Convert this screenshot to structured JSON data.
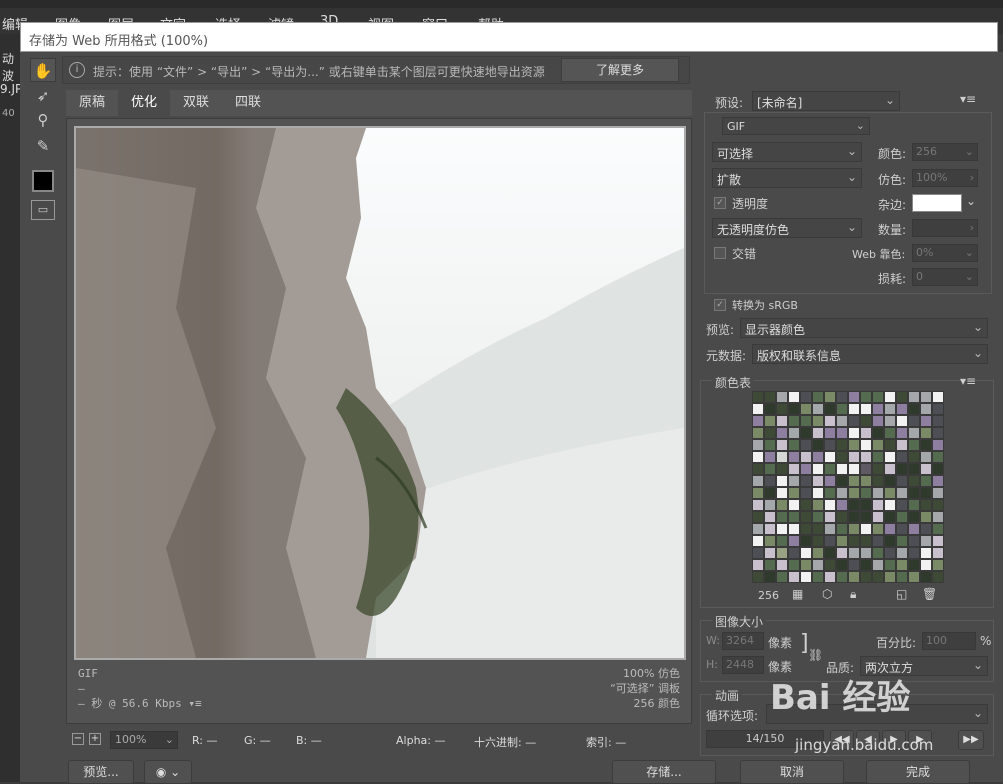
{
  "background_app": {
    "menu_items": [
      "编辑",
      "图像",
      "图层",
      "文字",
      "选择",
      "滤镜",
      "3D",
      "视图",
      "窗口",
      "帮助"
    ],
    "left_fragments": [
      "动波",
      "9.JP",
      "40"
    ]
  },
  "dialog": {
    "title": "存储为 Web 所用格式 (100%)",
    "hint": "提示：使用 “文件” > “导出” > “导出为...” 或右键单击某个图层可更快速地导出资源",
    "learn_more": "了解更多",
    "tabs": [
      {
        "label": "原稿"
      },
      {
        "label": "优化"
      },
      {
        "label": "双联"
      },
      {
        "label": "四联"
      }
    ],
    "preview_info": {
      "format": "GIF",
      "size": "—",
      "time": "— 秒 @ 56.6 Kbps",
      "dither": "100% 仿色",
      "palette": "“可选择” 调板",
      "colors": "256 颜色"
    },
    "status": {
      "zoom": "100%",
      "r": "R: —",
      "g": "G: —",
      "b": "B: —",
      "alpha": "Alpha: —",
      "hex": "十六进制: —",
      "index": "索引: —"
    },
    "buttons": {
      "preview": "预览...",
      "save": "存储...",
      "cancel": "取消",
      "done": "完成"
    }
  },
  "settings": {
    "preset_label": "预设:",
    "preset_value": "[未命名]",
    "format": "GIF",
    "reduction": "可选择",
    "dither_algo": "扩散",
    "transparency": "透明度",
    "matte_dither": "无透明度仿色",
    "interlaced": "交错",
    "colors_label": "颜色:",
    "colors_value": "256",
    "dither_label": "仿色:",
    "dither_value": "100%",
    "matte_label": "杂边:",
    "amount_label": "数量:",
    "web_snap_label": "Web 靠色:",
    "web_snap_value": "0%",
    "lossy_label": "损耗:",
    "lossy_value": "0",
    "convert_srgb": "转换为 sRGB",
    "preview_label": "预览:",
    "preview_value": "显示器颜色",
    "metadata_label": "元数据:",
    "metadata_value": "版权和联系信息"
  },
  "color_table": {
    "title": "颜色表",
    "count": "256"
  },
  "image_size": {
    "title": "图像大小",
    "w_label": "W:",
    "w_value": "3264",
    "h_label": "H:",
    "h_value": "2448",
    "unit": "像素",
    "percent_label": "百分比:",
    "percent_value": "100",
    "percent_unit": "%",
    "quality_label": "品质:",
    "quality_value": "两次立方"
  },
  "animation": {
    "title": "动画",
    "loop_label": "循环选项:",
    "frame": "14/150"
  },
  "watermark": {
    "text": "Bai  经验",
    "url": "jingyan.baidu.com"
  }
}
